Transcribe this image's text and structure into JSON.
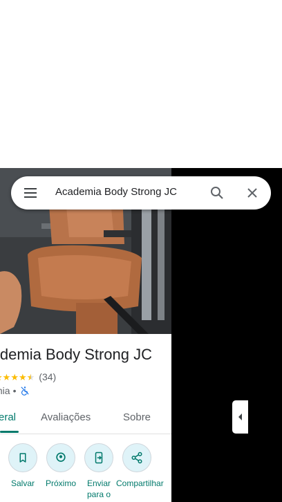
{
  "search": {
    "query": "Academia Body Strong JC"
  },
  "place": {
    "title": "Academia Body Strong JC",
    "rating_value": 4.5,
    "reviews": "(34)",
    "category": "mia",
    "separator": "•"
  },
  "tabs": [
    {
      "label": "eral",
      "active": true
    },
    {
      "label": "Avaliações",
      "active": false
    },
    {
      "label": "Sobre",
      "active": false
    }
  ],
  "actions": [
    {
      "label": "Salvar",
      "icon": "bookmark-icon"
    },
    {
      "label": "Próximo",
      "icon": "nearby-icon"
    },
    {
      "label": "Enviar para o",
      "icon": "send-to-phone-icon"
    },
    {
      "label": "Compartilhar",
      "icon": "share-icon"
    }
  ],
  "colors": {
    "accent": "#00796b",
    "star": "#fbbc04",
    "map_background": "#000000"
  }
}
